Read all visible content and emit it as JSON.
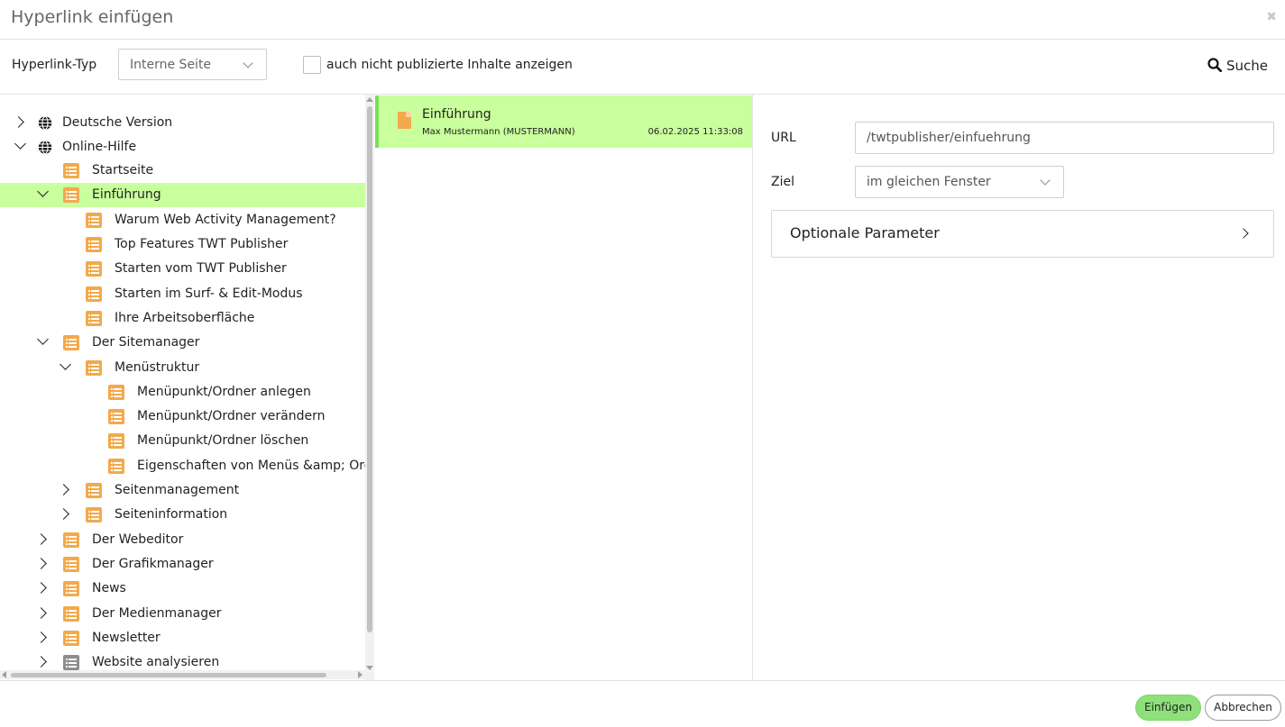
{
  "dialog": {
    "title": "Hyperlink einfügen",
    "close_glyph": "✖"
  },
  "toolbar": {
    "type_label": "Hyperlink-Typ",
    "type_value": "Interne Seite",
    "unpublished_checked": false,
    "unpublished_label": "auch nicht publizierte Inhalte anzeigen",
    "search_label": "Suche",
    "search_icon": "search-icon"
  },
  "tree": {
    "items": [
      {
        "label": "Deutsche Version",
        "level": 0,
        "state": "collapsed",
        "icon": "globe-icon",
        "selected": false
      },
      {
        "label": "Online-Hilfe",
        "level": 0,
        "state": "expanded",
        "icon": "globe-icon",
        "selected": false
      },
      {
        "label": "Startseite",
        "level": 1,
        "state": "leaf",
        "icon": "list-icon",
        "selected": false
      },
      {
        "label": "Einführung",
        "level": 1,
        "state": "expanded",
        "icon": "list-icon",
        "selected": true
      },
      {
        "label": "Warum Web Activity Management?",
        "level": 2,
        "state": "leaf",
        "icon": "list-icon",
        "selected": false
      },
      {
        "label": "Top Features TWT Publisher",
        "level": 2,
        "state": "leaf",
        "icon": "list-icon",
        "selected": false
      },
      {
        "label": "Starten vom TWT Publisher",
        "level": 2,
        "state": "leaf",
        "icon": "list-icon",
        "selected": false
      },
      {
        "label": "Starten im Surf- & Edit-Modus",
        "level": 2,
        "state": "leaf",
        "icon": "list-icon",
        "selected": false
      },
      {
        "label": "Ihre Arbeitsoberfläche",
        "level": 2,
        "state": "leaf",
        "icon": "list-icon",
        "selected": false
      },
      {
        "label": "Der Sitemanager",
        "level": 1,
        "state": "expanded",
        "icon": "list-icon",
        "selected": false
      },
      {
        "label": "Menüstruktur",
        "level": 2,
        "state": "expanded",
        "icon": "list-icon",
        "selected": false
      },
      {
        "label": "Menüpunkt/Ordner anlegen",
        "level": 3,
        "state": "leaf",
        "icon": "list-icon",
        "selected": false
      },
      {
        "label": "Menüpunkt/Ordner verändern",
        "level": 3,
        "state": "leaf",
        "icon": "list-icon",
        "selected": false
      },
      {
        "label": "Menüpunkt/Ordner löschen",
        "level": 3,
        "state": "leaf",
        "icon": "list-icon",
        "selected": false
      },
      {
        "label": "Eigenschaften von Menüs &amp; Ordn",
        "level": 3,
        "state": "leaf",
        "icon": "list-icon",
        "selected": false
      },
      {
        "label": "Seitenmanagement",
        "level": 2,
        "state": "collapsed",
        "icon": "list-icon",
        "selected": false
      },
      {
        "label": "Seiteninformation",
        "level": 2,
        "state": "collapsed",
        "icon": "list-icon",
        "selected": false
      },
      {
        "label": "Der Webeditor",
        "level": 1,
        "state": "collapsed",
        "icon": "list-icon",
        "selected": false
      },
      {
        "label": "Der Grafikmanager",
        "level": 1,
        "state": "collapsed",
        "icon": "list-icon",
        "selected": false
      },
      {
        "label": "News",
        "level": 1,
        "state": "collapsed",
        "icon": "list-icon",
        "selected": false
      },
      {
        "label": "Der Medienmanager",
        "level": 1,
        "state": "collapsed",
        "icon": "list-icon",
        "selected": false
      },
      {
        "label": "Newsletter",
        "level": 1,
        "state": "collapsed",
        "icon": "list-icon",
        "selected": false
      },
      {
        "label": "Website analysieren",
        "level": 1,
        "state": "collapsed",
        "icon": "list-icon-gray",
        "selected": false
      }
    ]
  },
  "pages": [
    {
      "title": "Einführung",
      "author": "Max Mustermann (MUSTERMANN)",
      "date": "06.02.2025 11:33:08",
      "icon": "document-icon"
    }
  ],
  "form": {
    "url_label": "URL",
    "url_value": "/twtpublisher/einfuehrung",
    "target_label": "Ziel",
    "target_value": "im gleichen Fenster",
    "optional_label": "Optionale Parameter"
  },
  "footer": {
    "insert_label": "Einfügen",
    "cancel_label": "Abbrechen"
  },
  "colors": {
    "selected_bg": "#c9ff9c",
    "selected_border": "#7ddc5a",
    "icon_orange": "#f3a94b",
    "icon_gray": "#8d8d8d",
    "primary_button": "#8ee07a"
  }
}
